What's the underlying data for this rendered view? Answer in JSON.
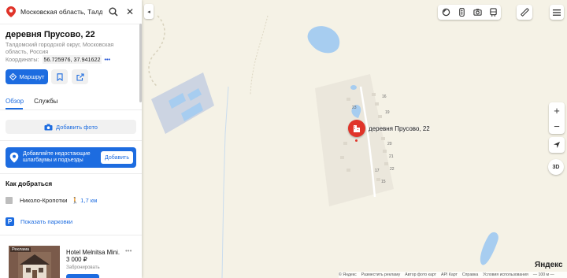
{
  "search": {
    "query": "Московская область, Талдомский",
    "pin_icon": "location-pin-icon",
    "search_icon": "search-icon",
    "close_glyph": "✕"
  },
  "place": {
    "title": "деревня Прусово, 22",
    "address": "Талдомский городской округ, Московская область, Россия",
    "coords_label": "Координаты:",
    "coords_value": "56.725976, 37.941622",
    "coords_more": "•••"
  },
  "actions": {
    "route_label": "Маршрут"
  },
  "tabs": [
    {
      "label": "Обзор",
      "active": true
    },
    {
      "label": "Службы",
      "active": false
    }
  ],
  "add_photo_label": "Добавить фото",
  "promo": {
    "text": "Добавляйте недостающие шлагбаумы и подъезды",
    "button": "Добавить"
  },
  "directions": {
    "title": "Как добраться",
    "station": "Николо-Кропотки",
    "distance": "1,7 км",
    "parking": "Показать парковки"
  },
  "ad": {
    "badge": "Реклама",
    "name": "Hotel Melnitsa Mini.",
    "price": "3 000 ₽",
    "status": "Забронировать",
    "more": "•••"
  },
  "map": {
    "collapse_glyph": "◂",
    "marker_label": "деревня Прусово, 22",
    "zoom_in": "+",
    "zoom_out": "−",
    "three_d": "3D",
    "logo": "Яндекс",
    "house_numbers": [
      "23",
      "16",
      "19",
      "20",
      "21",
      "22",
      "17",
      "15"
    ],
    "footer": [
      "© Яндекс",
      "Разместить рекламу",
      "Автор фото карт",
      "API Карт",
      "Справка",
      "Условия использования",
      "— 100 м —"
    ],
    "toolbar_icons": [
      "layers-icon",
      "traffic-icon",
      "panorama-icon",
      "transit-icon",
      "ruler-icon",
      "menu-icon"
    ],
    "colors": {
      "water": "#a7cdf0",
      "accent": "#1d6ce0",
      "marker": "#e0342a"
    }
  }
}
